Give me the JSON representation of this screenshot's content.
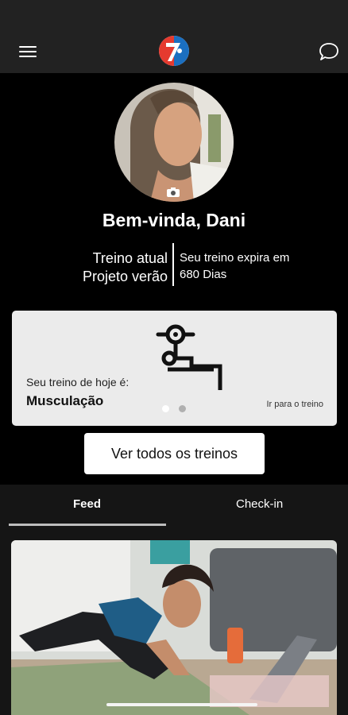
{
  "header": {
    "menu_icon": "hamburger-menu-icon",
    "logo_icon": "brand-logo-icon",
    "chat_icon": "chat-bubble-icon"
  },
  "profile": {
    "greeting": "Bem-vinda, Dani",
    "plan_label": "Treino atual",
    "plan_name": "Projeto verão",
    "expires_text": "Seu treino expira em",
    "expires_days": "680 Dias",
    "camera_icon": "camera-icon"
  },
  "today": {
    "label": "Seu treino de hoje é:",
    "workout": "Musculação",
    "link": "Ir para o treino",
    "icon": "weightlifting-bench-icon",
    "carousel_page": 1,
    "carousel_total": 2
  },
  "actions": {
    "see_all": "Ver todos os treinos"
  },
  "tabs": [
    {
      "label": "Feed",
      "active": true
    },
    {
      "label": "Check-in",
      "active": false
    }
  ],
  "colors": {
    "background": "#000000",
    "appbar": "#222222",
    "card": "#ebebeb",
    "tab_indicator": "#bdbdbd",
    "logo_red": "#e53a2f",
    "logo_blue": "#1b6fc0"
  }
}
